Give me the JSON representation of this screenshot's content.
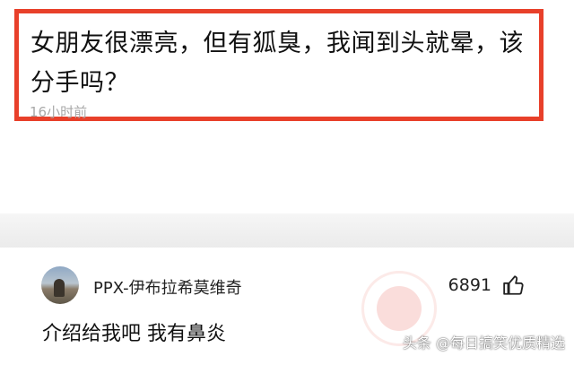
{
  "post": {
    "title": "女朋友很漂亮，但有狐臭，我闻到头就晕，该分手吗？",
    "time": "16小时前"
  },
  "comment": {
    "username": "PPX-伊布拉希莫维奇",
    "like_count": "6891",
    "body": "介绍给我吧 我有鼻炎"
  },
  "watermark": "头条 @每日搞笑优质精选",
  "icons": {
    "like": "thumbs-up-icon",
    "avatar": "avatar-photo",
    "stamp": "god-comment-stamp"
  },
  "colors": {
    "highlight_border": "#e8402a",
    "timestamp": "#a8a8a8"
  }
}
